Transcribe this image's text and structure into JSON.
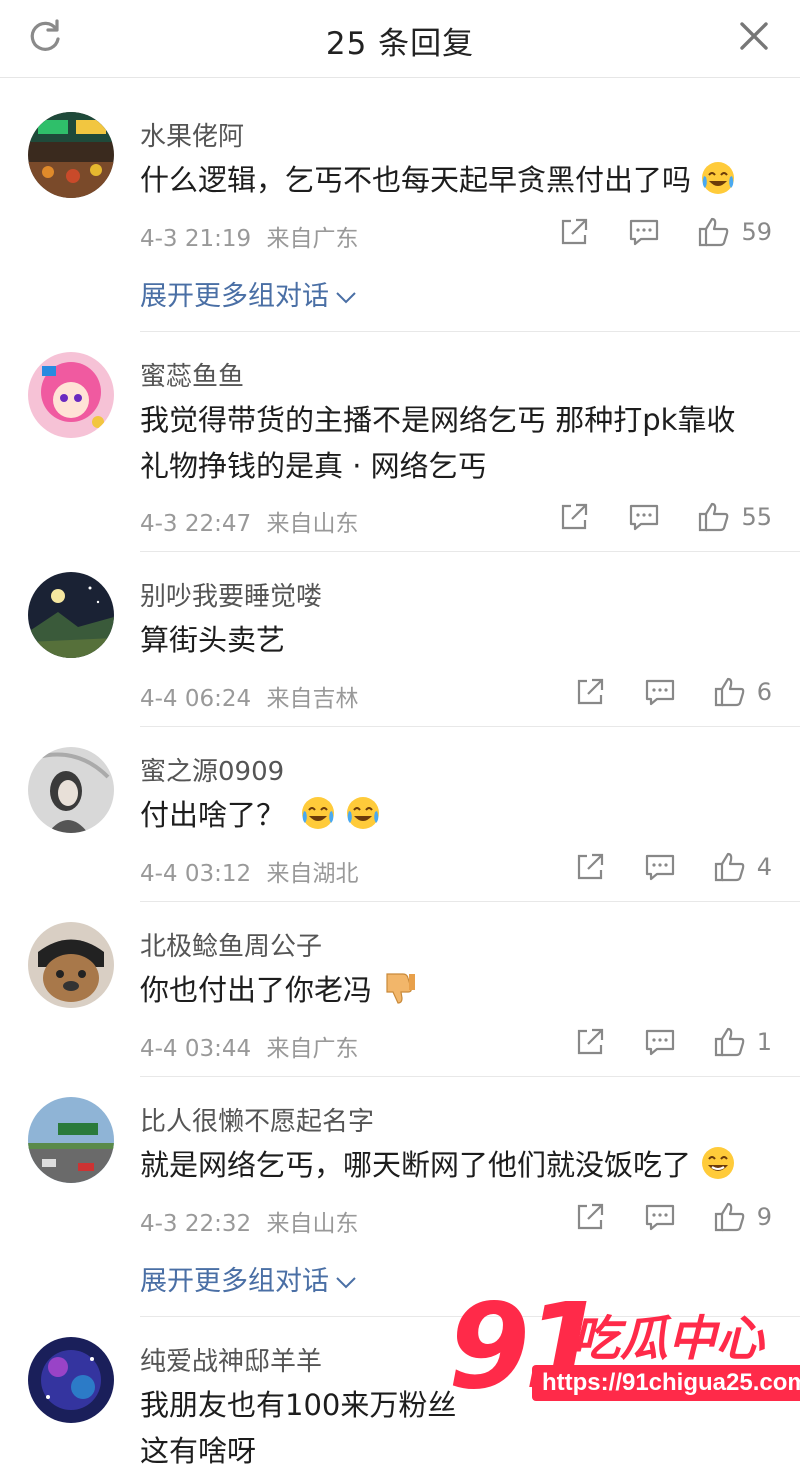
{
  "header": {
    "title": "25 条回复"
  },
  "comments": [
    {
      "user": "水果佬阿",
      "text": "什么逻辑，乞丐不也每天起早贪黑付出了吗",
      "emoji": [
        "laugh-cry"
      ],
      "time": "4-3 21:19",
      "location": "来自广东",
      "likes": "59",
      "expand": "展开更多组对话"
    },
    {
      "user": "蜜蕊鱼鱼",
      "text": "我觉得带货的主播不是网络乞丐 那种打pk靠收",
      "text2": "礼物挣钱的是真 · 网络乞丐",
      "time": "4-3 22:47",
      "location": "来自山东",
      "likes": "55"
    },
    {
      "user": "别吵我要睡觉喽",
      "text": "算街头卖艺",
      "time": "4-4 06:24",
      "location": "来自吉林",
      "likes": "6"
    },
    {
      "user": "蜜之源0909",
      "text": "付出啥了？",
      "emoji": [
        "laugh-cry",
        "laugh-cry"
      ],
      "time": "4-4 03:12",
      "location": "来自湖北",
      "likes": "4"
    },
    {
      "user": "北极鲶鱼周公子",
      "text": "你也付出了你老冯",
      "emoji": [
        "thumbs-down"
      ],
      "time": "4-4 03:44",
      "location": "来自广东",
      "likes": "1"
    },
    {
      "user": "比人很懒不愿起名字",
      "text": "就是网络乞丐，哪天断网了他们就没饭吃了",
      "emoji": [
        "laugh"
      ],
      "time": "4-3 22:32",
      "location": "来自山东",
      "likes": "9",
      "expand": "展开更多组对话"
    },
    {
      "user": "纯爱战神邸羊羊",
      "text": "我朋友也有100来万粉丝",
      "text2": "这有啥呀",
      "time": "",
      "location": "",
      "likes": ""
    }
  ],
  "watermark": {
    "number": "91",
    "name": "吃瓜中心",
    "url": "https://91chigua25.com"
  },
  "colors": {
    "link": "#4a6fa5",
    "watermark": "#ff2a49"
  }
}
